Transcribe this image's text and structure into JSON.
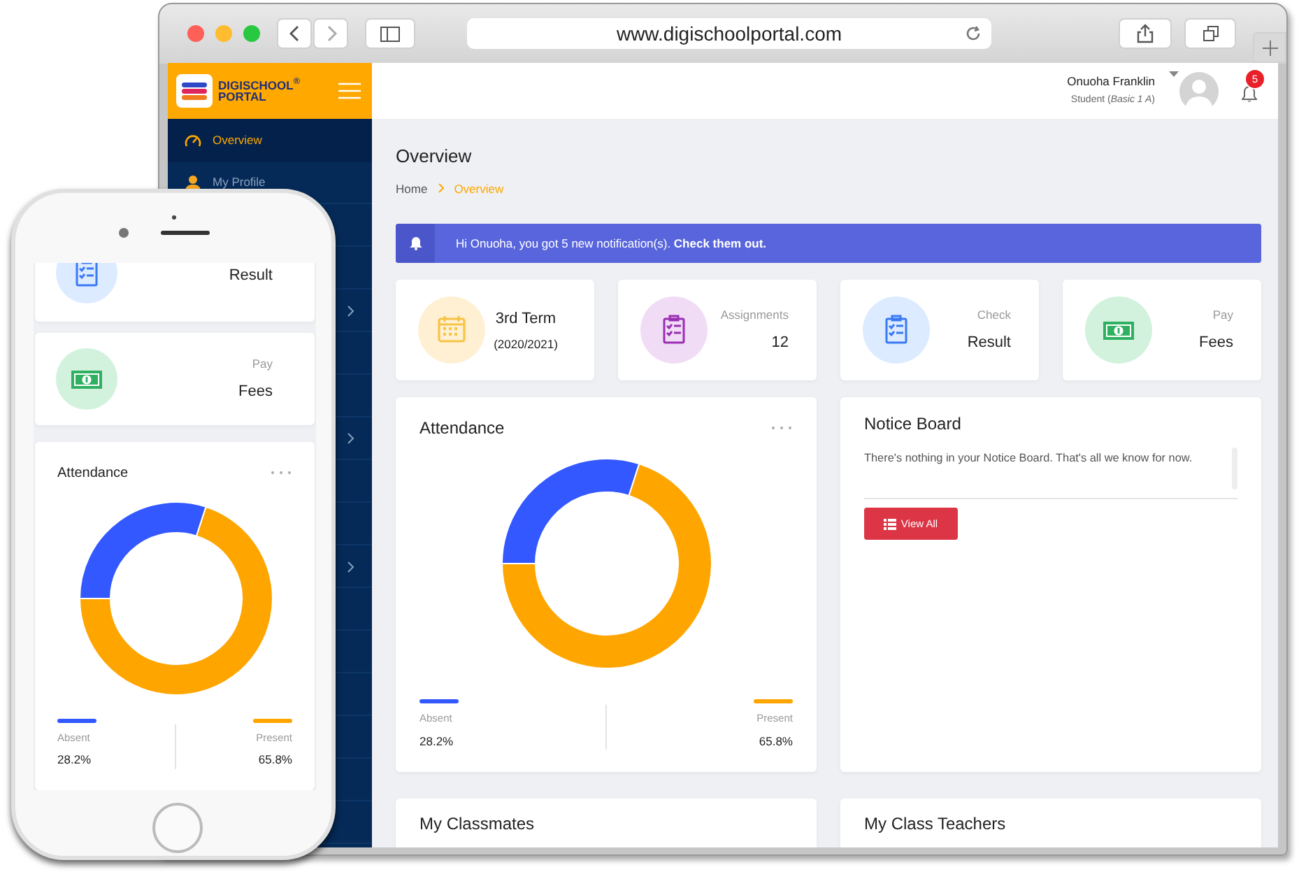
{
  "browser": {
    "url": "www.digischoolportal.com"
  },
  "app": {
    "logo": {
      "line1": "DIGISCHOOL$^{®}$",
      "line2": "PORTAL"
    },
    "sidebar": {
      "items": [
        {
          "label": "Overview",
          "selected": true,
          "has_submenu": false
        },
        {
          "label": "My Profile",
          "selected": false,
          "has_submenu": false
        },
        {
          "has_submenu": false
        },
        {
          "has_submenu": false
        },
        {
          "has_submenu": true
        },
        {
          "has_submenu": false
        },
        {
          "has_submenu": false
        },
        {
          "has_submenu": true
        },
        {
          "has_submenu": false
        },
        {
          "has_submenu": false
        },
        {
          "has_submenu": true
        }
      ]
    },
    "user": {
      "name": "Onuoha Franklin",
      "role": "Student (*Basic 1 A*)",
      "notifications": "5"
    },
    "page_title": "Overview",
    "breadcrumb": [
      {
        "label": "Home",
        "selected": false
      },
      {
        "label": "Overview",
        "selected": true
      }
    ],
    "alert": {
      "text": "Hi Onuoha, you got 5 new notification(s). **Check them out.**"
    },
    "stats": [
      {
        "kind": "term",
        "title": "3rd Term",
        "subtitle": "(2020/2021)"
      },
      {
        "kind": "assignments",
        "label": "Assignments",
        "value": "12"
      },
      {
        "kind": "result",
        "label": "Check",
        "value": "Result"
      },
      {
        "kind": "fees",
        "label": "Pay",
        "value": "Fees"
      }
    ],
    "attendance": {
      "chart_data": {
        "type": "donut",
        "title": "Attendance",
        "categories": [
          "Absent",
          "Present"
        ],
        "series": [
          {
            "values": [
              30,
              70
            ]
          }
        ],
        "value_labels": [
          "28.2%",
          "65.8%"
        ]
      },
      "legend": [
        {
          "color": "#3358ff"
        },
        {
          "color": "#ffa500"
        }
      ]
    },
    "notice_board": {
      "title": "Notice Board",
      "text": "There's nothing in your Notice Board. That's all we know for now.",
      "button": "View All"
    },
    "bottom_cards": [
      {
        "title": "My Classmates"
      },
      {
        "title": "My Class Teachers"
      }
    ]
  },
  "phone": {
    "stats": [
      {
        "kind": "result",
        "value": "Result"
      },
      {
        "kind": "fees",
        "label": "Pay",
        "value": "Fees"
      }
    ],
    "attendance": {
      "chart_data": {
        "type": "donut",
        "title": "Attendance",
        "categories": [
          "Absent",
          "Present"
        ],
        "series": [
          {
            "values": [
              30,
              70
            ]
          }
        ],
        "value_labels": [
          "28.2%",
          "65.8%"
        ]
      },
      "legend": [
        {
          "color": "#3358ff"
        },
        {
          "color": "#ffa500"
        }
      ]
    }
  }
}
